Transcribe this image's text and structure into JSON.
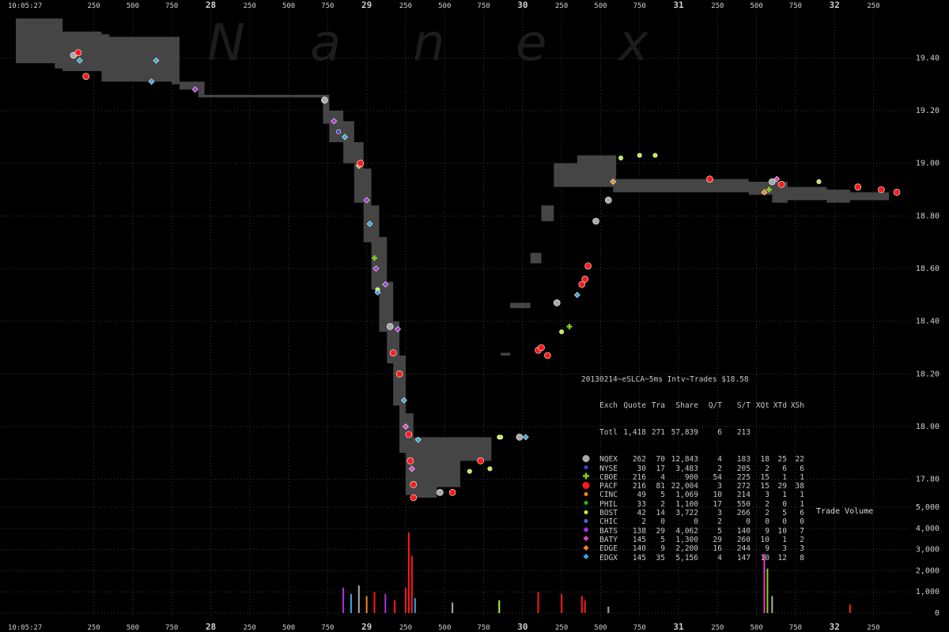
{
  "watermark": {
    "letters": [
      "N",
      "a",
      "n",
      "e",
      "x"
    ]
  },
  "x_axis": {
    "start_label": "10:05:27",
    "ticks": [
      {
        "t": 27.25,
        "label": "250"
      },
      {
        "t": 27.5,
        "label": "500"
      },
      {
        "t": 27.75,
        "label": "750"
      },
      {
        "t": 28,
        "label": "28"
      },
      {
        "t": 28.25,
        "label": "250"
      },
      {
        "t": 28.5,
        "label": "500"
      },
      {
        "t": 28.75,
        "label": "750"
      },
      {
        "t": 29,
        "label": "29"
      },
      {
        "t": 29.25,
        "label": "250"
      },
      {
        "t": 29.5,
        "label": "500"
      },
      {
        "t": 29.75,
        "label": "750"
      },
      {
        "t": 30,
        "label": "30"
      },
      {
        "t": 30.25,
        "label": "250"
      },
      {
        "t": 30.5,
        "label": "500"
      },
      {
        "t": 30.75,
        "label": "750"
      },
      {
        "t": 31,
        "label": "31"
      },
      {
        "t": 31.25,
        "label": "250"
      },
      {
        "t": 31.5,
        "label": "500"
      },
      {
        "t": 31.75,
        "label": "750"
      },
      {
        "t": 32,
        "label": "32"
      },
      {
        "t": 32.25,
        "label": "250"
      }
    ]
  },
  "price_axis": {
    "ticks": [
      "19.40",
      "19.20",
      "19.00",
      "18.80",
      "18.60",
      "18.40",
      "18.20",
      "18.00",
      "17.80"
    ]
  },
  "volume_axis": {
    "ticks": [
      "5,000",
      "4,000",
      "3,000",
      "2,000",
      "1,000",
      "0"
    ],
    "title": "Trade Volume"
  },
  "stats_table": {
    "title": "20130214~eSLCA~5ms Intv~Trades $18.58",
    "headers": [
      "Exch",
      "Quote",
      "Tra",
      "Share",
      "Q/T",
      "S/T",
      "XQt",
      "XTd",
      "XSh"
    ],
    "total": [
      "Totl",
      "1,418",
      "271",
      "57,839",
      "6",
      "213",
      "",
      "",
      ""
    ],
    "rows": [
      {
        "exch": "NQEX",
        "quote": "262",
        "tra": "70",
        "share": "12,843",
        "qt": "4",
        "st": "183",
        "xqt": "18",
        "xtd": "25",
        "xsh": "22",
        "color": "#aaaaaa",
        "marker": "circle-lg"
      },
      {
        "exch": "NYSE",
        "quote": "30",
        "tra": "17",
        "share": "3,483",
        "qt": "2",
        "st": "205",
        "xqt": "2",
        "xtd": "6",
        "xsh": "6",
        "color": "#3f3fd0",
        "marker": "circle-sm"
      },
      {
        "exch": "CBOE",
        "quote": "216",
        "tra": "4",
        "share": "900",
        "qt": "54",
        "st": "225",
        "xqt": "15",
        "xtd": "1",
        "xsh": "1",
        "color": "#88cc22",
        "marker": "cross"
      },
      {
        "exch": "PACF",
        "quote": "216",
        "tra": "81",
        "share": "22,004",
        "qt": "3",
        "st": "272",
        "xqt": "15",
        "xtd": "29",
        "xsh": "38",
        "color": "#ff1a1a",
        "marker": "circle-lg"
      },
      {
        "exch": "CINC",
        "quote": "49",
        "tra": "5",
        "share": "1,069",
        "qt": "10",
        "st": "214",
        "xqt": "3",
        "xtd": "1",
        "xsh": "1",
        "color": "#ff8800",
        "marker": "circle-sm"
      },
      {
        "exch": "PHIL",
        "quote": "33",
        "tra": "2",
        "share": "1,100",
        "qt": "17",
        "st": "550",
        "xqt": "2",
        "xtd": "0",
        "xsh": "1",
        "color": "#22bb22",
        "marker": "circle-sm"
      },
      {
        "exch": "BOST",
        "quote": "42",
        "tra": "14",
        "share": "3,722",
        "qt": "3",
        "st": "266",
        "xqt": "2",
        "xtd": "5",
        "xsh": "6",
        "color": "#bbee44",
        "marker": "circle-sm"
      },
      {
        "exch": "CHIC",
        "quote": "2",
        "tra": "0",
        "share": "0",
        "qt": "2",
        "st": "0",
        "xqt": "0",
        "xtd": "0",
        "xsh": "0",
        "color": "#3b6fd8",
        "marker": "circle-sm"
      },
      {
        "exch": "BATS",
        "quote": "138",
        "tra": "29",
        "share": "4,062",
        "qt": "5",
        "st": "140",
        "xqt": "9",
        "xtd": "10",
        "xsh": "7",
        "color": "#aa33dd",
        "marker": "diamond"
      },
      {
        "exch": "BATY",
        "quote": "145",
        "tra": "5",
        "share": "1,300",
        "qt": "29",
        "st": "260",
        "xqt": "10",
        "xtd": "1",
        "xsh": "2",
        "color": "#e040c8",
        "marker": "diamond"
      },
      {
        "exch": "EDGE",
        "quote": "140",
        "tra": "9",
        "share": "2,200",
        "qt": "16",
        "st": "244",
        "xqt": "9",
        "xtd": "3",
        "xsh": "3",
        "color": "#ee8822",
        "marker": "diamond"
      },
      {
        "exch": "EDGX",
        "quote": "145",
        "tra": "35",
        "share": "5,156",
        "qt": "4",
        "st": "147",
        "xqt": "10",
        "xtd": "12",
        "xsh": "8",
        "color": "#33aadd",
        "marker": "diamond"
      }
    ]
  },
  "chart_data": {
    "type": "line",
    "title": "20130214~eSLCA~5ms Intv~Trades $18.58",
    "x_unit": "seconds after 10:05",
    "xlim": [
      26.75,
      32.43
    ],
    "price_ylim": [
      17.7,
      19.56
    ],
    "volume_ylim": [
      0,
      5000
    ],
    "quote_band": [
      {
        "x": 26.75,
        "lo": 19.38,
        "hi": 19.55
      },
      {
        "x": 27.0,
        "lo": 19.38,
        "hi": 19.55
      },
      {
        "x": 27.05,
        "lo": 19.36,
        "hi": 19.5
      },
      {
        "x": 27.3,
        "lo": 19.35,
        "hi": 19.49
      },
      {
        "x": 27.35,
        "lo": 19.31,
        "hi": 19.48
      },
      {
        "x": 27.75,
        "lo": 19.31,
        "hi": 19.48
      },
      {
        "x": 27.8,
        "lo": 19.3,
        "hi": 19.31
      },
      {
        "x": 27.92,
        "lo": 19.28,
        "hi": 19.31
      },
      {
        "x": 27.96,
        "lo": 19.25,
        "hi": 19.26
      },
      {
        "x": 28.72,
        "lo": 19.25,
        "hi": 19.26
      },
      {
        "x": 28.76,
        "lo": 19.15,
        "hi": 19.2
      },
      {
        "x": 28.85,
        "lo": 19.08,
        "hi": 19.16
      },
      {
        "x": 28.92,
        "lo": 19.0,
        "hi": 19.08
      },
      {
        "x": 28.98,
        "lo": 18.85,
        "hi": 18.98
      },
      {
        "x": 29.03,
        "lo": 18.7,
        "hi": 18.84
      },
      {
        "x": 29.08,
        "lo": 18.52,
        "hi": 18.72
      },
      {
        "x": 29.13,
        "lo": 18.36,
        "hi": 18.55
      },
      {
        "x": 29.17,
        "lo": 18.24,
        "hi": 18.4
      },
      {
        "x": 29.21,
        "lo": 18.08,
        "hi": 18.27
      },
      {
        "x": 29.25,
        "lo": 17.9,
        "hi": 18.05
      },
      {
        "x": 29.3,
        "lo": 17.74,
        "hi": 17.96
      },
      {
        "x": 29.45,
        "lo": 17.73,
        "hi": 17.96
      },
      {
        "x": 29.6,
        "lo": 17.77,
        "hi": 17.96
      },
      {
        "x": 29.8,
        "lo": 17.87,
        "hi": 17.96
      },
      {
        "x": 29.86,
        "lo": 17.96,
        "hi": 18.28
      },
      {
        "x": 29.92,
        "lo": 18.27,
        "hi": 18.47
      },
      {
        "x": 30.05,
        "lo": 18.45,
        "hi": 18.66
      },
      {
        "x": 30.12,
        "lo": 18.62,
        "hi": 18.78
      },
      {
        "x": 30.2,
        "lo": 18.84,
        "hi": 19.0
      },
      {
        "x": 30.35,
        "lo": 18.91,
        "hi": 19.03
      },
      {
        "x": 30.58,
        "lo": 18.91,
        "hi": 19.03
      },
      {
        "x": 30.6,
        "lo": 18.89,
        "hi": 18.94
      },
      {
        "x": 31.3,
        "lo": 18.89,
        "hi": 18.94
      },
      {
        "x": 31.45,
        "lo": 18.89,
        "hi": 18.93
      },
      {
        "x": 31.6,
        "lo": 18.88,
        "hi": 18.93
      },
      {
        "x": 31.7,
        "lo": 18.85,
        "hi": 18.91
      },
      {
        "x": 31.95,
        "lo": 18.86,
        "hi": 18.9
      },
      {
        "x": 32.1,
        "lo": 18.85,
        "hi": 18.89
      },
      {
        "x": 32.3,
        "lo": 18.86,
        "hi": 18.89
      }
    ],
    "trades": [
      {
        "x": 27.12,
        "y": 19.41,
        "ex": "NQEX"
      },
      {
        "x": 27.16,
        "y": 19.39,
        "ex": "EDGX"
      },
      {
        "x": 27.15,
        "y": 19.42,
        "ex": "PACF"
      },
      {
        "x": 27.2,
        "y": 19.33,
        "ex": "PACF"
      },
      {
        "x": 27.62,
        "y": 19.31,
        "ex": "EDGX"
      },
      {
        "x": 27.65,
        "y": 19.39,
        "ex": "EDGX"
      },
      {
        "x": 27.9,
        "y": 19.28,
        "ex": "BATS"
      },
      {
        "x": 28.73,
        "y": 19.24,
        "ex": "NQEX"
      },
      {
        "x": 28.79,
        "y": 19.16,
        "ex": "BATS"
      },
      {
        "x": 28.82,
        "y": 19.12,
        "ex": "NYSE"
      },
      {
        "x": 28.86,
        "y": 19.1,
        "ex": "EDGX"
      },
      {
        "x": 28.95,
        "y": 18.99,
        "ex": "EDGE"
      },
      {
        "x": 28.96,
        "y": 19.0,
        "ex": "PACF"
      },
      {
        "x": 29.0,
        "y": 18.86,
        "ex": "BATS"
      },
      {
        "x": 29.02,
        "y": 18.77,
        "ex": "EDGX"
      },
      {
        "x": 29.05,
        "y": 18.64,
        "ex": "CBOE"
      },
      {
        "x": 29.06,
        "y": 18.6,
        "ex": "BATS"
      },
      {
        "x": 29.07,
        "y": 18.52,
        "ex": "BOST"
      },
      {
        "x": 29.07,
        "y": 18.51,
        "ex": "EDGX"
      },
      {
        "x": 29.12,
        "y": 18.54,
        "ex": "BATS"
      },
      {
        "x": 29.15,
        "y": 18.38,
        "ex": "NQEX"
      },
      {
        "x": 29.17,
        "y": 18.28,
        "ex": "PACF"
      },
      {
        "x": 29.2,
        "y": 18.37,
        "ex": "BATS"
      },
      {
        "x": 29.21,
        "y": 18.2,
        "ex": "PACF"
      },
      {
        "x": 29.24,
        "y": 18.1,
        "ex": "EDGX"
      },
      {
        "x": 29.25,
        "y": 18.0,
        "ex": "BATY"
      },
      {
        "x": 29.27,
        "y": 17.97,
        "ex": "PACF"
      },
      {
        "x": 29.28,
        "y": 17.87,
        "ex": "PACF"
      },
      {
        "x": 29.29,
        "y": 17.84,
        "ex": "BATY"
      },
      {
        "x": 29.3,
        "y": 17.78,
        "ex": "PACF"
      },
      {
        "x": 29.3,
        "y": 17.73,
        "ex": "PACF"
      },
      {
        "x": 29.33,
        "y": 17.95,
        "ex": "EDGX"
      },
      {
        "x": 29.47,
        "y": 17.75,
        "ex": "NQEX"
      },
      {
        "x": 29.55,
        "y": 17.75,
        "ex": "PACF"
      },
      {
        "x": 29.66,
        "y": 17.83,
        "ex": "BOST"
      },
      {
        "x": 29.73,
        "y": 17.87,
        "ex": "PACF"
      },
      {
        "x": 29.79,
        "y": 17.84,
        "ex": "BOST"
      },
      {
        "x": 29.85,
        "y": 17.96,
        "ex": "BOST"
      },
      {
        "x": 29.86,
        "y": 17.96,
        "ex": "BOST"
      },
      {
        "x": 29.98,
        "y": 17.96,
        "ex": "NQEX"
      },
      {
        "x": 30.02,
        "y": 17.96,
        "ex": "EDGX"
      },
      {
        "x": 30.1,
        "y": 18.29,
        "ex": "PACF"
      },
      {
        "x": 30.12,
        "y": 18.3,
        "ex": "PACF"
      },
      {
        "x": 30.16,
        "y": 18.27,
        "ex": "PACF"
      },
      {
        "x": 30.22,
        "y": 18.47,
        "ex": "NQEX"
      },
      {
        "x": 30.25,
        "y": 18.36,
        "ex": "BOST"
      },
      {
        "x": 30.3,
        "y": 18.38,
        "ex": "CBOE"
      },
      {
        "x": 30.35,
        "y": 18.5,
        "ex": "EDGX"
      },
      {
        "x": 30.38,
        "y": 18.54,
        "ex": "PACF"
      },
      {
        "x": 30.4,
        "y": 18.56,
        "ex": "PACF"
      },
      {
        "x": 30.42,
        "y": 18.61,
        "ex": "PACF"
      },
      {
        "x": 30.47,
        "y": 18.78,
        "ex": "NQEX"
      },
      {
        "x": 30.55,
        "y": 18.86,
        "ex": "NQEX"
      },
      {
        "x": 30.58,
        "y": 18.93,
        "ex": "EDGE"
      },
      {
        "x": 30.63,
        "y": 19.02,
        "ex": "BOST"
      },
      {
        "x": 30.75,
        "y": 19.03,
        "ex": "BOST"
      },
      {
        "x": 30.85,
        "y": 19.03,
        "ex": "BOST"
      },
      {
        "x": 31.2,
        "y": 18.94,
        "ex": "PACF"
      },
      {
        "x": 31.55,
        "y": 18.89,
        "ex": "EDGE"
      },
      {
        "x": 31.58,
        "y": 18.9,
        "ex": "CBOE"
      },
      {
        "x": 31.6,
        "y": 18.93,
        "ex": "NQEX"
      },
      {
        "x": 31.63,
        "y": 18.94,
        "ex": "BATY"
      },
      {
        "x": 31.66,
        "y": 18.92,
        "ex": "PACF"
      },
      {
        "x": 31.9,
        "y": 18.93,
        "ex": "BOST"
      },
      {
        "x": 32.15,
        "y": 18.91,
        "ex": "PACF"
      },
      {
        "x": 32.3,
        "y": 18.9,
        "ex": "PACF"
      },
      {
        "x": 32.4,
        "y": 18.89,
        "ex": "PACF"
      }
    ],
    "volume": [
      {
        "x": 28.85,
        "v": 1200,
        "ex": "BATS"
      },
      {
        "x": 28.9,
        "v": 900,
        "ex": "EDGX"
      },
      {
        "x": 28.95,
        "v": 1300,
        "ex": "NQEX"
      },
      {
        "x": 29.0,
        "v": 800,
        "ex": "EDGE"
      },
      {
        "x": 29.05,
        "v": 1000,
        "ex": "PACF"
      },
      {
        "x": 29.12,
        "v": 900,
        "ex": "BATS"
      },
      {
        "x": 29.18,
        "v": 600,
        "ex": "PACF"
      },
      {
        "x": 29.25,
        "v": 1200,
        "ex": "PACF"
      },
      {
        "x": 29.27,
        "v": 3800,
        "ex": "PACF"
      },
      {
        "x": 29.29,
        "v": 2700,
        "ex": "PACF"
      },
      {
        "x": 29.31,
        "v": 700,
        "ex": "EDGX"
      },
      {
        "x": 29.55,
        "v": 500,
        "ex": "NQEX"
      },
      {
        "x": 29.85,
        "v": 600,
        "ex": "BOST"
      },
      {
        "x": 30.1,
        "v": 1000,
        "ex": "PACF"
      },
      {
        "x": 30.25,
        "v": 900,
        "ex": "PACF"
      },
      {
        "x": 30.38,
        "v": 800,
        "ex": "PACF"
      },
      {
        "x": 30.4,
        "v": 600,
        "ex": "PACF"
      },
      {
        "x": 30.55,
        "v": 300,
        "ex": "NQEX"
      },
      {
        "x": 31.55,
        "v": 2800,
        "ex": "BATY"
      },
      {
        "x": 31.57,
        "v": 2100,
        "ex": "CBOE"
      },
      {
        "x": 31.6,
        "v": 800,
        "ex": "NQEX"
      },
      {
        "x": 32.1,
        "v": 400,
        "ex": "PACF"
      }
    ]
  }
}
